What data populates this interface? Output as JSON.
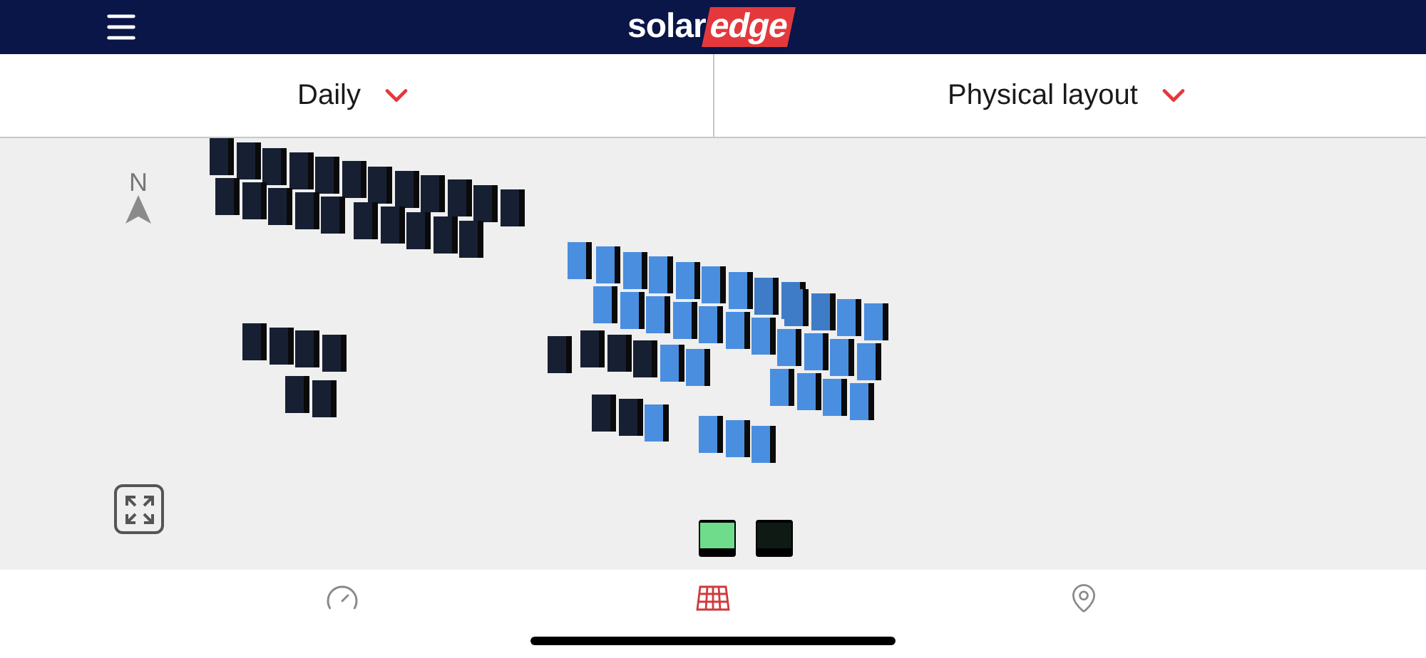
{
  "header": {
    "logo": {
      "part_1": "solar",
      "part_2": "edge"
    }
  },
  "selectors": [
    {
      "label": "Daily"
    },
    {
      "label": "Physical layout"
    }
  ],
  "compass": {
    "label": "N"
  },
  "layout": {
    "groups": [
      {
        "rows": [
          [
            {
              "color": "#172033"
            },
            {
              "color": "#172033"
            },
            {
              "color": "#172033"
            },
            {
              "color": "#172033"
            },
            {
              "color": "#172033"
            },
            {
              "color": "#172033"
            },
            {
              "color": "#172033"
            },
            {
              "color": "#172033"
            },
            {
              "color": "#172033"
            },
            {
              "color": "#172033"
            },
            {
              "color": "#172033"
            },
            {
              "color": "#172033"
            }
          ]
        ]
      },
      {
        "rows": [
          [
            {
              "color": "#172033"
            },
            {
              "color": "#172033"
            },
            {
              "color": "#172033"
            },
            {
              "color": "#172033"
            },
            {
              "color": "#172033"
            }
          ]
        ]
      },
      {
        "rows": [
          [
            {
              "color": "#172033"
            },
            {
              "color": "#172033"
            },
            {
              "color": "#172033"
            },
            {
              "color": "#172033"
            },
            {
              "color": "#172033"
            }
          ]
        ]
      },
      {
        "rows": [
          [
            {
              "color": "#172033"
            },
            {
              "color": "#172033"
            },
            {
              "color": "#172033"
            },
            {
              "color": "#172033"
            }
          ]
        ]
      },
      {
        "rows": [
          [
            {
              "color": "#172033"
            },
            {
              "color": "#172033"
            }
          ]
        ]
      },
      {
        "rows": [
          [
            {
              "color": "#4a8ee0"
            }
          ]
        ]
      },
      {
        "rows": [
          [
            {
              "color": "#4a8ee0"
            },
            {
              "color": "#4a8ee0"
            },
            {
              "color": "#4a8ee0"
            },
            {
              "color": "#4a8ee0"
            },
            {
              "color": "#4a8ee0"
            },
            {
              "color": "#4a8ee0"
            },
            {
              "color": "#3f7cc8"
            },
            {
              "color": "#3f7cc8"
            }
          ]
        ]
      },
      {
        "rows": [
          [
            {
              "color": "#4a8ee0"
            },
            {
              "color": "#4a8ee0"
            },
            {
              "color": "#4a8ee0"
            },
            {
              "color": "#4a8ee0"
            },
            {
              "color": "#4a8ee0"
            },
            {
              "color": "#4a8ee0"
            },
            {
              "color": "#4a8ee0"
            }
          ]
        ]
      },
      {
        "rows": [
          [
            {
              "color": "#172033"
            }
          ]
        ]
      },
      {
        "rows": [
          [
            {
              "color": "#172033"
            },
            {
              "color": "#172033"
            },
            {
              "color": "#172033"
            },
            {
              "color": "#4a8ee0"
            },
            {
              "color": "#4a8ee0"
            }
          ]
        ]
      },
      {
        "rows": [
          [
            {
              "color": "#3f7cc8"
            },
            {
              "color": "#3f7cc8"
            },
            {
              "color": "#4a8ee0"
            },
            {
              "color": "#4a8ee0"
            }
          ],
          [
            {
              "color": "#4a8ee0"
            },
            {
              "color": "#4a8ee0"
            },
            {
              "color": "#4a8ee0"
            },
            {
              "color": "#4a8ee0"
            }
          ],
          [
            {
              "color": "#4a8ee0"
            },
            {
              "color": "#4a8ee0"
            },
            {
              "color": "#4a8ee0"
            },
            {
              "color": "#4a8ee0"
            }
          ]
        ]
      },
      {
        "rows": [
          [
            {
              "color": "#172033"
            },
            {
              "color": "#172033"
            },
            {
              "color": "#4a8ee0"
            }
          ]
        ]
      },
      {
        "rows": [
          [
            {
              "color": "#4a8ee0"
            },
            {
              "color": "#4a8ee0"
            },
            {
              "color": "#4a8ee0"
            }
          ]
        ]
      }
    ]
  },
  "inverters": [
    {
      "color": "#6fdc8c"
    },
    {
      "color": "#101a14"
    }
  ],
  "bottom_nav": [
    {
      "kind": "dashboard",
      "selected": false
    },
    {
      "kind": "layout",
      "selected": true
    },
    {
      "kind": "location",
      "selected": false
    }
  ]
}
